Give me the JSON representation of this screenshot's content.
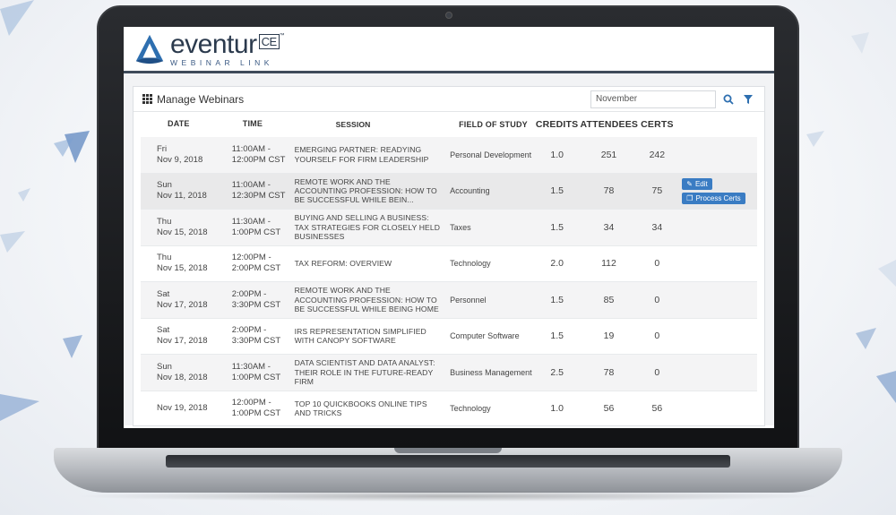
{
  "app": {
    "logo_word": "eventur",
    "logo_badge": "CE",
    "logo_tm": "™",
    "logo_sub": "WEBINAR LINK"
  },
  "panel": {
    "title": "Manage Webinars",
    "filter_value": "November",
    "search_icon": "search-icon",
    "filter_icon": "filter-icon"
  },
  "table": {
    "headers": {
      "date": "DATE",
      "time": "TIME",
      "session": "SESSION",
      "field": "FIELD OF STUDY",
      "credits": "CREDITS",
      "attendees": "ATTENDEES",
      "certs": "CERTS"
    },
    "rows": [
      {
        "day": "Fri",
        "date": "Nov 9, 2018",
        "time": "11:00AM - 12:00PM CST",
        "session": "Emerging Partner: Readying Yourself for Firm Leadership",
        "field": "Personal Development",
        "credits": "1.0",
        "attendees": "251",
        "certs": "242"
      },
      {
        "day": "Sun",
        "date": "Nov 11, 2018",
        "time": "11:00AM - 12:30PM CST",
        "session": "Remote Work and the Accounting Profession: How to be Successful While Bein...",
        "field": "Accounting",
        "credits": "1.5",
        "attendees": "78",
        "certs": "75"
      },
      {
        "day": "Thu",
        "date": "Nov 15, 2018",
        "time": "11:30AM - 1:00PM CST",
        "session": "Buying and Selling a Business: Tax Strategies for Closely Held Businesses",
        "field": "Taxes",
        "credits": "1.5",
        "attendees": "34",
        "certs": "34"
      },
      {
        "day": "Thu",
        "date": "Nov 15, 2018",
        "time": "12:00PM - 2:00PM CST",
        "session": "Tax Reform: Overview",
        "field": "Technology",
        "credits": "2.0",
        "attendees": "112",
        "certs": "0"
      },
      {
        "day": "Sat",
        "date": "Nov 17, 2018",
        "time": "2:00PM - 3:30PM CST",
        "session": "Remote Work and the Accounting Profession: How to be Successful While Being Home",
        "field": "Personnel",
        "credits": "1.5",
        "attendees": "85",
        "certs": "0"
      },
      {
        "day": "Sat",
        "date": "Nov 17, 2018",
        "time": "2:00PM - 3:30PM CST",
        "session": "IRS Representation Simplified with Canopy Software",
        "field": "Computer Software",
        "credits": "1.5",
        "attendees": "19",
        "certs": "0"
      },
      {
        "day": "Sun",
        "date": "Nov 18, 2018",
        "time": "11:30AM - 1:00PM CST",
        "session": "Data Scientist and Data Analyst: Their Role in the Future-Ready Firm",
        "field": "Business Management",
        "credits": "2.5",
        "attendees": "78",
        "certs": "0"
      },
      {
        "day": "",
        "date": "Nov 19, 2018",
        "time": "12:00PM - 1:00PM CST",
        "session": "Top 10 QuickBooks Online Tips and Tricks",
        "field": "Technology",
        "credits": "1.0",
        "attendees": "56",
        "certs": "56"
      }
    ],
    "actions": {
      "edit_label": "Edit",
      "process_label": "Process Certs"
    }
  },
  "colors": {
    "accent": "#3a7cc3",
    "header_rule": "#3f4b5a",
    "logo_blue": "#2e6fb0"
  }
}
